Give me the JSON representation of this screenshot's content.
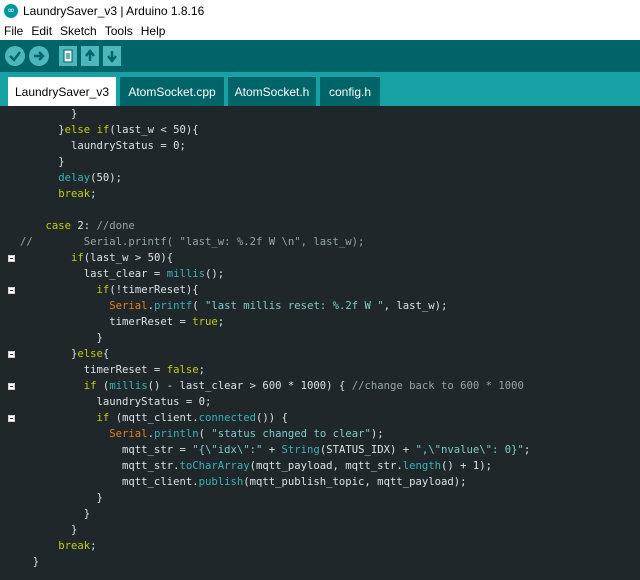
{
  "window": {
    "title": "LaundrySaver_v3 | Arduino 1.8.16",
    "logo_glyph": "∞"
  },
  "menubar": {
    "items": [
      "File",
      "Edit",
      "Sketch",
      "Tools",
      "Help"
    ]
  },
  "toolbar": {
    "buttons": [
      {
        "name": "verify-button",
        "icon": "checkmark-icon",
        "glyph": "✓"
      },
      {
        "name": "upload-button",
        "icon": "arrow-right-icon",
        "glyph": "➜"
      },
      {
        "name": "new-button",
        "icon": "new-file-icon",
        "glyph": "▤"
      },
      {
        "name": "open-button",
        "icon": "arrow-up-icon",
        "glyph": "⬆"
      },
      {
        "name": "save-button",
        "icon": "arrow-down-icon",
        "glyph": "⬇"
      }
    ]
  },
  "tabs": [
    {
      "label": "LaundrySaver_v3",
      "active": true
    },
    {
      "label": "AtomSocket.cpp",
      "active": false
    },
    {
      "label": "AtomSocket.h",
      "active": false
    },
    {
      "label": "config.h",
      "active": false
    }
  ],
  "colors": {
    "editor_background": "#1f272a",
    "toolbar": "#006468",
    "tabbar": "#17a1a5",
    "keyword": "#c1cd0d",
    "function": "#3bb2b8",
    "object": "#e67e22",
    "comment": "#95a5a6",
    "default_text": "#dae3e3"
  },
  "code": [
    {
      "fold": false,
      "tokens": [
        {
          "t": "        }",
          "k": "default"
        }
      ]
    },
    {
      "fold": false,
      "tokens": [
        {
          "t": "      }",
          "k": "default"
        },
        {
          "t": "else",
          "k": "keyword"
        },
        {
          "t": " ",
          "k": "default"
        },
        {
          "t": "if",
          "k": "keyword"
        },
        {
          "t": "(last_w < 50){",
          "k": "default"
        }
      ]
    },
    {
      "fold": false,
      "tokens": [
        {
          "t": "        laundryStatus = 0;",
          "k": "default"
        }
      ]
    },
    {
      "fold": false,
      "tokens": [
        {
          "t": "      }",
          "k": "default"
        }
      ]
    },
    {
      "fold": false,
      "tokens": [
        {
          "t": "      ",
          "k": "default"
        },
        {
          "t": "delay",
          "k": "function"
        },
        {
          "t": "(50);",
          "k": "default"
        }
      ]
    },
    {
      "fold": false,
      "tokens": [
        {
          "t": "      ",
          "k": "default"
        },
        {
          "t": "break",
          "k": "keyword"
        },
        {
          "t": ";",
          "k": "default"
        }
      ]
    },
    {
      "fold": false,
      "tokens": [
        {
          "t": "",
          "k": "default"
        }
      ]
    },
    {
      "fold": false,
      "tokens": [
        {
          "t": "    ",
          "k": "default"
        },
        {
          "t": "case",
          "k": "keyword"
        },
        {
          "t": " 2: ",
          "k": "default"
        },
        {
          "t": "//done",
          "k": "comment"
        }
      ]
    },
    {
      "fold": false,
      "tokens": [
        {
          "t": "//        Serial.printf( \"last_w: %.2f W \\n\", last_w);",
          "k": "comment"
        }
      ]
    },
    {
      "fold": true,
      "tokens": [
        {
          "t": "        ",
          "k": "default"
        },
        {
          "t": "if",
          "k": "keyword"
        },
        {
          "t": "(last_w > 50){",
          "k": "default"
        }
      ]
    },
    {
      "fold": false,
      "tokens": [
        {
          "t": "          last_clear = ",
          "k": "default"
        },
        {
          "t": "millis",
          "k": "function"
        },
        {
          "t": "();",
          "k": "default"
        }
      ]
    },
    {
      "fold": true,
      "tokens": [
        {
          "t": "            ",
          "k": "default"
        },
        {
          "t": "if",
          "k": "keyword"
        },
        {
          "t": "(!timerReset){",
          "k": "default"
        }
      ]
    },
    {
      "fold": false,
      "tokens": [
        {
          "t": "              ",
          "k": "default"
        },
        {
          "t": "Serial",
          "k": "object"
        },
        {
          "t": ".",
          "k": "default"
        },
        {
          "t": "printf",
          "k": "function"
        },
        {
          "t": "( ",
          "k": "default"
        },
        {
          "t": "\"last millis reset: %.2f W \"",
          "k": "string"
        },
        {
          "t": ", last_w);",
          "k": "default"
        }
      ]
    },
    {
      "fold": false,
      "tokens": [
        {
          "t": "              timerReset = ",
          "k": "default"
        },
        {
          "t": "true",
          "k": "keyword"
        },
        {
          "t": ";",
          "k": "default"
        }
      ]
    },
    {
      "fold": false,
      "tokens": [
        {
          "t": "            }",
          "k": "default"
        }
      ]
    },
    {
      "fold": true,
      "tokens": [
        {
          "t": "        }",
          "k": "default"
        },
        {
          "t": "else",
          "k": "keyword"
        },
        {
          "t": "{",
          "k": "default"
        }
      ]
    },
    {
      "fold": false,
      "tokens": [
        {
          "t": "          timerReset = ",
          "k": "default"
        },
        {
          "t": "false",
          "k": "keyword"
        },
        {
          "t": ";",
          "k": "default"
        }
      ]
    },
    {
      "fold": true,
      "tokens": [
        {
          "t": "          ",
          "k": "default"
        },
        {
          "t": "if",
          "k": "keyword"
        },
        {
          "t": " (",
          "k": "default"
        },
        {
          "t": "millis",
          "k": "function"
        },
        {
          "t": "() - last_clear > 600 * 1000) { ",
          "k": "default"
        },
        {
          "t": "//change back to 600 * 1000",
          "k": "comment"
        }
      ]
    },
    {
      "fold": false,
      "tokens": [
        {
          "t": "            laundryStatus = 0;",
          "k": "default"
        }
      ]
    },
    {
      "fold": true,
      "tokens": [
        {
          "t": "            ",
          "k": "default"
        },
        {
          "t": "if",
          "k": "keyword"
        },
        {
          "t": " (mqtt_client.",
          "k": "default"
        },
        {
          "t": "connected",
          "k": "function"
        },
        {
          "t": "()) {",
          "k": "default"
        }
      ]
    },
    {
      "fold": false,
      "tokens": [
        {
          "t": "              ",
          "k": "default"
        },
        {
          "t": "Serial",
          "k": "object"
        },
        {
          "t": ".",
          "k": "default"
        },
        {
          "t": "println",
          "k": "function"
        },
        {
          "t": "( ",
          "k": "default"
        },
        {
          "t": "\"status changed to clear\"",
          "k": "string"
        },
        {
          "t": ");",
          "k": "default"
        }
      ]
    },
    {
      "fold": false,
      "tokens": [
        {
          "t": "                mqtt_str = ",
          "k": "default"
        },
        {
          "t": "\"{\\\"idx\\\":\"",
          "k": "string"
        },
        {
          "t": " + ",
          "k": "default"
        },
        {
          "t": "String",
          "k": "function"
        },
        {
          "t": "(STATUS_IDX) + ",
          "k": "default"
        },
        {
          "t": "\",\\\"nvalue\\\": 0}\"",
          "k": "string"
        },
        {
          "t": ";",
          "k": "default"
        }
      ]
    },
    {
      "fold": false,
      "tokens": [
        {
          "t": "                mqtt_str.",
          "k": "default"
        },
        {
          "t": "toCharArray",
          "k": "function"
        },
        {
          "t": "(mqtt_payload, mqtt_str.",
          "k": "default"
        },
        {
          "t": "length",
          "k": "function"
        },
        {
          "t": "() + 1);",
          "k": "default"
        }
      ]
    },
    {
      "fold": false,
      "tokens": [
        {
          "t": "                mqtt_client.",
          "k": "default"
        },
        {
          "t": "publish",
          "k": "function"
        },
        {
          "t": "(mqtt_publish_topic, mqtt_payload);",
          "k": "default"
        }
      ]
    },
    {
      "fold": false,
      "tokens": [
        {
          "t": "            }",
          "k": "default"
        }
      ]
    },
    {
      "fold": false,
      "tokens": [
        {
          "t": "          }",
          "k": "default"
        }
      ]
    },
    {
      "fold": false,
      "tokens": [
        {
          "t": "        }",
          "k": "default"
        }
      ]
    },
    {
      "fold": false,
      "tokens": [
        {
          "t": "      ",
          "k": "default"
        },
        {
          "t": "break",
          "k": "keyword"
        },
        {
          "t": ";",
          "k": "default"
        }
      ]
    },
    {
      "fold": false,
      "tokens": [
        {
          "t": "  }",
          "k": "default"
        }
      ]
    }
  ]
}
